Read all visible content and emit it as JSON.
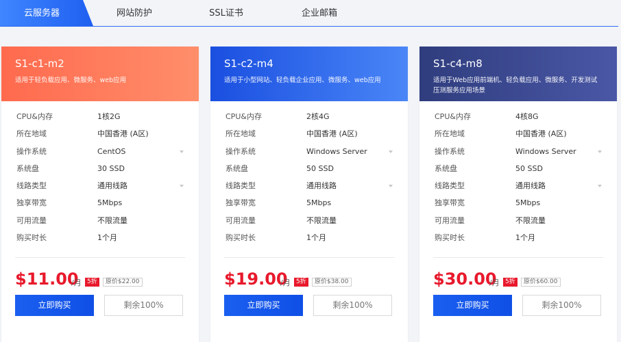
{
  "tabs": [
    {
      "label": "云服务器"
    },
    {
      "label": "网站防护"
    },
    {
      "label": "SSL证书"
    },
    {
      "label": "企业邮箱"
    }
  ],
  "spec_labels": [
    "CPU&内存",
    "所在地域",
    "操作系统",
    "系统盘",
    "线路类型",
    "独享带宽",
    "可用流量",
    "购买时长"
  ],
  "cards": [
    {
      "title": "S1-c1-m2",
      "desc": "适用于轻负载应用、微服务、web应用",
      "specs": [
        "1核2G",
        "中国香港 (A区)",
        "CentOS",
        "30 SSD",
        "通用线路",
        "5Mbps",
        "不限流量",
        "1个月"
      ],
      "price": "$11.00",
      "per": "/月",
      "discount": "5折",
      "original": "原价$22.00",
      "buy_label": "立即购买",
      "stock_label": "剩余100%"
    },
    {
      "title": "S1-c2-m4",
      "desc": "适用于小型网站、轻负载企业应用、微服务、web应用",
      "specs": [
        "2核4G",
        "中国香港 (A区)",
        "Windows Server",
        "50 SSD",
        "通用线路",
        "5Mbps",
        "不限流量",
        "1个月"
      ],
      "price": "$19.00",
      "per": "/月",
      "discount": "5折",
      "original": "原价$38.00",
      "buy_label": "立即购买",
      "stock_label": "剩余100%"
    },
    {
      "title": "S1-c4-m8",
      "desc": "适用于Web应用前端机、轻负载应用、微服务、开发测试压测服务应用场景",
      "specs": [
        "4核8G",
        "中国香港 (A区)",
        "Windows Server",
        "50 SSD",
        "通用线路",
        "5Mbps",
        "不限流量",
        "1个月"
      ],
      "price": "$30.00",
      "per": "/月",
      "discount": "5折",
      "original": "原价$60.00",
      "buy_label": "立即购买",
      "stock_label": "剩余100%"
    }
  ],
  "colors": {
    "accent": "#1a5ff0",
    "price": "#e8192c",
    "card1_header": "#ff6a4e",
    "card2_header": "#1a4fe0",
    "card3_header": "#2f3d7e"
  }
}
